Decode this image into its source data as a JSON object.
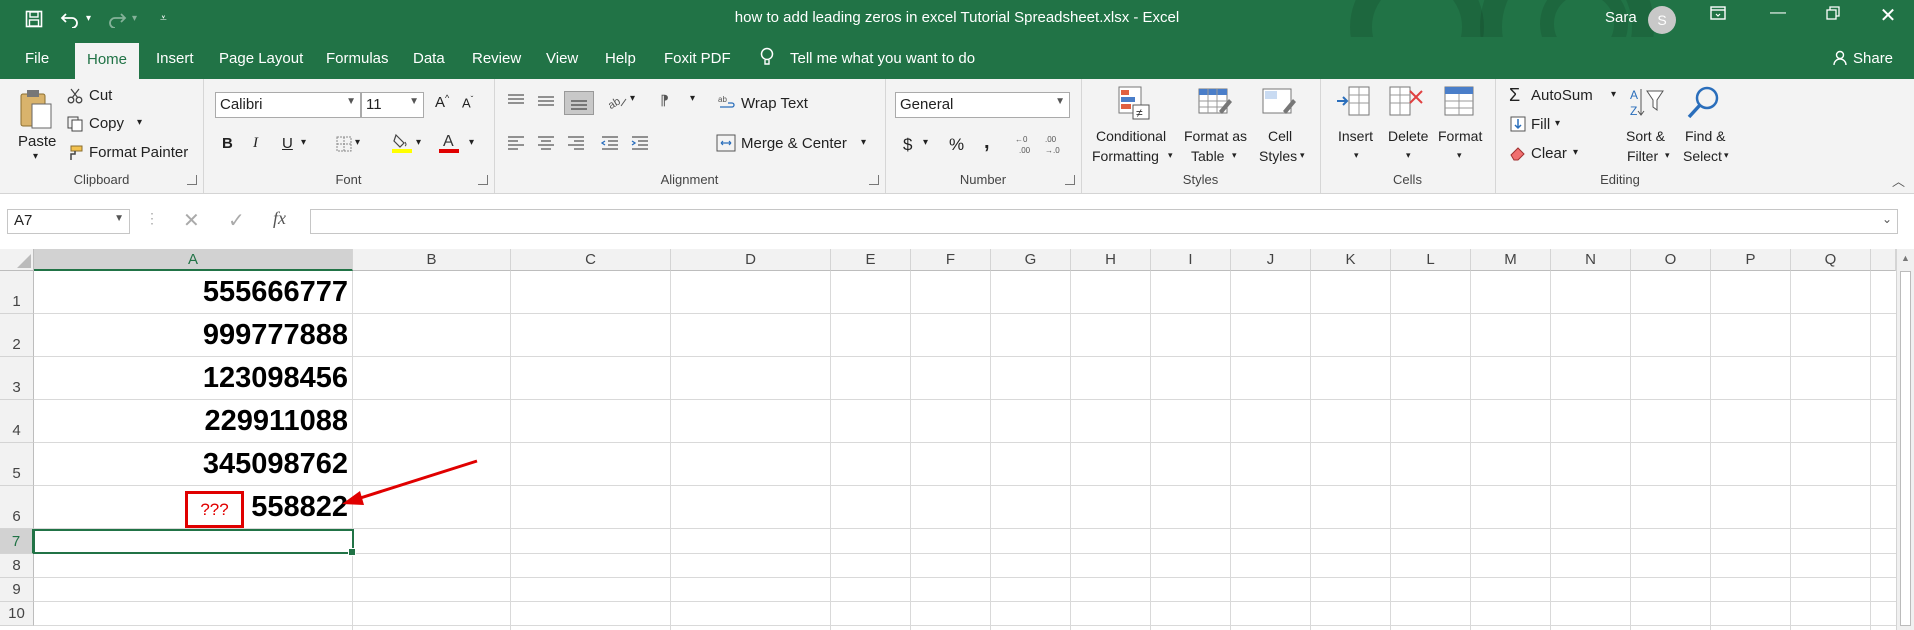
{
  "window": {
    "title": "how to add leading zeros in excel Tutorial Spreadsheet.xlsx  -  Excel",
    "user_name": "Sara",
    "user_initial": "S"
  },
  "tabs": [
    {
      "label": "File"
    },
    {
      "label": "Home"
    },
    {
      "label": "Insert"
    },
    {
      "label": "Page Layout"
    },
    {
      "label": "Formulas"
    },
    {
      "label": "Data"
    },
    {
      "label": "Review"
    },
    {
      "label": "View"
    },
    {
      "label": "Help"
    },
    {
      "label": "Foxit PDF"
    }
  ],
  "tell_me": "Tell me what you want to do",
  "share": "Share",
  "ribbon": {
    "clipboard": {
      "label": "Clipboard",
      "paste": "Paste",
      "cut": "Cut",
      "copy": "Copy",
      "format_painter": "Format Painter"
    },
    "font": {
      "label": "Font",
      "family": "Calibri",
      "size": "11",
      "bold": "B",
      "italic": "I",
      "underline": "U"
    },
    "alignment": {
      "label": "Alignment",
      "wrap_text": "Wrap Text",
      "merge_center": "Merge & Center"
    },
    "number": {
      "label": "Number",
      "format": "General",
      "currency": "$",
      "percent": "%",
      "comma": ","
    },
    "styles": {
      "label": "Styles",
      "cond_fmt_1": "Conditional",
      "cond_fmt_2": "Formatting",
      "fmt_table_1": "Format as",
      "fmt_table_2": "Table",
      "cell_styles_1": "Cell",
      "cell_styles_2": "Styles"
    },
    "cells": {
      "label": "Cells",
      "insert": "Insert",
      "delete": "Delete",
      "format": "Format"
    },
    "editing": {
      "label": "Editing",
      "autosum": "AutoSum",
      "fill": "Fill",
      "clear": "Clear",
      "sort_1": "Sort &",
      "sort_2": "Filter",
      "find_1": "Find &",
      "find_2": "Select"
    }
  },
  "formula_bar": {
    "name_box": "A7",
    "fx": "fx",
    "formula": ""
  },
  "columns": [
    "A",
    "B",
    "C",
    "D",
    "E",
    "F",
    "G",
    "H",
    "I",
    "J",
    "K",
    "L",
    "M",
    "N",
    "O",
    "P",
    "Q"
  ],
  "rows": [
    "1",
    "2",
    "3",
    "4",
    "5",
    "6",
    "7",
    "8",
    "9",
    "10"
  ],
  "cells": {
    "A1": "555666777",
    "A2": "999777888",
    "A3": "123098456",
    "A4": "229911088",
    "A5": "345098762",
    "A6": "558822"
  },
  "annotation": {
    "text": "???",
    "color": "#e00000"
  },
  "colors": {
    "brand": "#217346",
    "ribbon_bg": "#f3f3f3"
  }
}
